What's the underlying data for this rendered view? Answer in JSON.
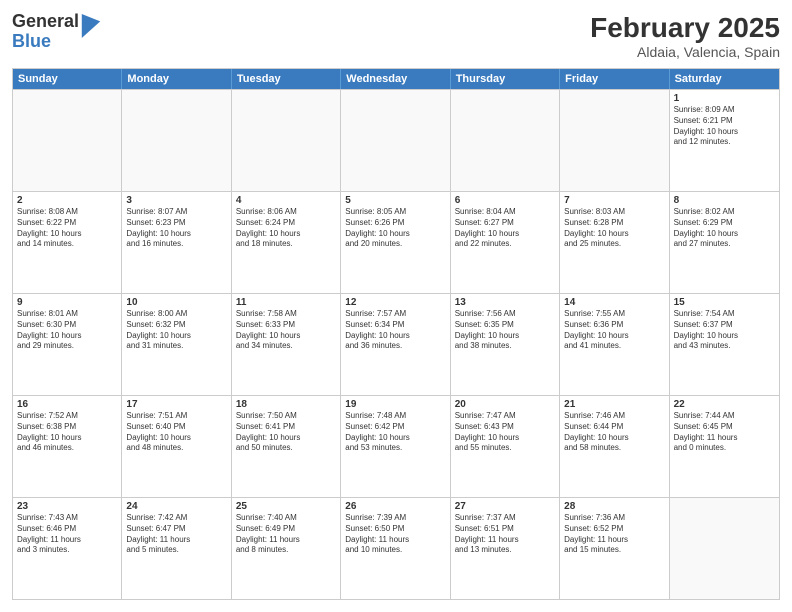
{
  "logo": {
    "general": "General",
    "blue": "Blue"
  },
  "title": {
    "month": "February 2025",
    "location": "Aldaia, Valencia, Spain"
  },
  "header": {
    "days": [
      "Sunday",
      "Monday",
      "Tuesday",
      "Wednesday",
      "Thursday",
      "Friday",
      "Saturday"
    ]
  },
  "weeks": [
    [
      {
        "day": "",
        "text": ""
      },
      {
        "day": "",
        "text": ""
      },
      {
        "day": "",
        "text": ""
      },
      {
        "day": "",
        "text": ""
      },
      {
        "day": "",
        "text": ""
      },
      {
        "day": "",
        "text": ""
      },
      {
        "day": "1",
        "text": "Sunrise: 8:09 AM\nSunset: 6:21 PM\nDaylight: 10 hours\nand 12 minutes."
      }
    ],
    [
      {
        "day": "2",
        "text": "Sunrise: 8:08 AM\nSunset: 6:22 PM\nDaylight: 10 hours\nand 14 minutes."
      },
      {
        "day": "3",
        "text": "Sunrise: 8:07 AM\nSunset: 6:23 PM\nDaylight: 10 hours\nand 16 minutes."
      },
      {
        "day": "4",
        "text": "Sunrise: 8:06 AM\nSunset: 6:24 PM\nDaylight: 10 hours\nand 18 minutes."
      },
      {
        "day": "5",
        "text": "Sunrise: 8:05 AM\nSunset: 6:26 PM\nDaylight: 10 hours\nand 20 minutes."
      },
      {
        "day": "6",
        "text": "Sunrise: 8:04 AM\nSunset: 6:27 PM\nDaylight: 10 hours\nand 22 minutes."
      },
      {
        "day": "7",
        "text": "Sunrise: 8:03 AM\nSunset: 6:28 PM\nDaylight: 10 hours\nand 25 minutes."
      },
      {
        "day": "8",
        "text": "Sunrise: 8:02 AM\nSunset: 6:29 PM\nDaylight: 10 hours\nand 27 minutes."
      }
    ],
    [
      {
        "day": "9",
        "text": "Sunrise: 8:01 AM\nSunset: 6:30 PM\nDaylight: 10 hours\nand 29 minutes."
      },
      {
        "day": "10",
        "text": "Sunrise: 8:00 AM\nSunset: 6:32 PM\nDaylight: 10 hours\nand 31 minutes."
      },
      {
        "day": "11",
        "text": "Sunrise: 7:58 AM\nSunset: 6:33 PM\nDaylight: 10 hours\nand 34 minutes."
      },
      {
        "day": "12",
        "text": "Sunrise: 7:57 AM\nSunset: 6:34 PM\nDaylight: 10 hours\nand 36 minutes."
      },
      {
        "day": "13",
        "text": "Sunrise: 7:56 AM\nSunset: 6:35 PM\nDaylight: 10 hours\nand 38 minutes."
      },
      {
        "day": "14",
        "text": "Sunrise: 7:55 AM\nSunset: 6:36 PM\nDaylight: 10 hours\nand 41 minutes."
      },
      {
        "day": "15",
        "text": "Sunrise: 7:54 AM\nSunset: 6:37 PM\nDaylight: 10 hours\nand 43 minutes."
      }
    ],
    [
      {
        "day": "16",
        "text": "Sunrise: 7:52 AM\nSunset: 6:38 PM\nDaylight: 10 hours\nand 46 minutes."
      },
      {
        "day": "17",
        "text": "Sunrise: 7:51 AM\nSunset: 6:40 PM\nDaylight: 10 hours\nand 48 minutes."
      },
      {
        "day": "18",
        "text": "Sunrise: 7:50 AM\nSunset: 6:41 PM\nDaylight: 10 hours\nand 50 minutes."
      },
      {
        "day": "19",
        "text": "Sunrise: 7:48 AM\nSunset: 6:42 PM\nDaylight: 10 hours\nand 53 minutes."
      },
      {
        "day": "20",
        "text": "Sunrise: 7:47 AM\nSunset: 6:43 PM\nDaylight: 10 hours\nand 55 minutes."
      },
      {
        "day": "21",
        "text": "Sunrise: 7:46 AM\nSunset: 6:44 PM\nDaylight: 10 hours\nand 58 minutes."
      },
      {
        "day": "22",
        "text": "Sunrise: 7:44 AM\nSunset: 6:45 PM\nDaylight: 11 hours\nand 0 minutes."
      }
    ],
    [
      {
        "day": "23",
        "text": "Sunrise: 7:43 AM\nSunset: 6:46 PM\nDaylight: 11 hours\nand 3 minutes."
      },
      {
        "day": "24",
        "text": "Sunrise: 7:42 AM\nSunset: 6:47 PM\nDaylight: 11 hours\nand 5 minutes."
      },
      {
        "day": "25",
        "text": "Sunrise: 7:40 AM\nSunset: 6:49 PM\nDaylight: 11 hours\nand 8 minutes."
      },
      {
        "day": "26",
        "text": "Sunrise: 7:39 AM\nSunset: 6:50 PM\nDaylight: 11 hours\nand 10 minutes."
      },
      {
        "day": "27",
        "text": "Sunrise: 7:37 AM\nSunset: 6:51 PM\nDaylight: 11 hours\nand 13 minutes."
      },
      {
        "day": "28",
        "text": "Sunrise: 7:36 AM\nSunset: 6:52 PM\nDaylight: 11 hours\nand 15 minutes."
      },
      {
        "day": "",
        "text": ""
      }
    ]
  ]
}
